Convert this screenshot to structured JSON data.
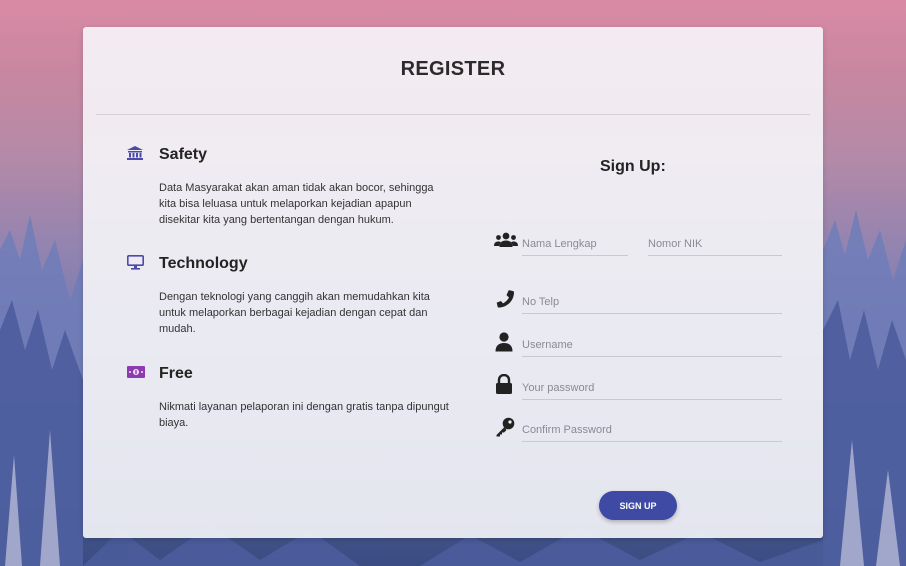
{
  "page": {
    "title": "REGISTER"
  },
  "features": [
    {
      "icon": "bank-icon",
      "heading": "Safety",
      "text": "Data Masyarakat akan aman tidak akan bocor, sehingga kita bisa leluasa untuk melaporkan kejadian apapun disekitar kita yang bertentangan dengan hukum."
    },
    {
      "icon": "monitor-icon",
      "heading": "Technology",
      "text": "Dengan teknologi yang canggih akan memudahkan kita untuk melaporkan berbagai kejadian dengan cepat dan mudah."
    },
    {
      "icon": "money-icon",
      "heading": "Free",
      "text": "Nikmati layanan pelaporan ini dengan gratis tanpa dipungut biaya."
    }
  ],
  "form": {
    "title": "Sign Up:",
    "fields": {
      "nama": {
        "icon": "users-icon",
        "placeholder": "Nama Lengkap",
        "value": ""
      },
      "nik": {
        "placeholder": "Nomor NIK",
        "value": ""
      },
      "telp": {
        "icon": "phone-icon",
        "placeholder": "No Telp",
        "value": ""
      },
      "username": {
        "icon": "user-icon",
        "placeholder": "Username",
        "value": ""
      },
      "password": {
        "icon": "lock-icon",
        "placeholder": "Your password",
        "value": ""
      },
      "confirm": {
        "icon": "key-icon",
        "placeholder": "Confirm Password",
        "value": ""
      }
    },
    "submit_label": "SIGN UP"
  },
  "colors": {
    "accent": "#3e4aa3",
    "icon_blue": "#4b4aa8",
    "icon_purple": "#8e3ab0"
  }
}
